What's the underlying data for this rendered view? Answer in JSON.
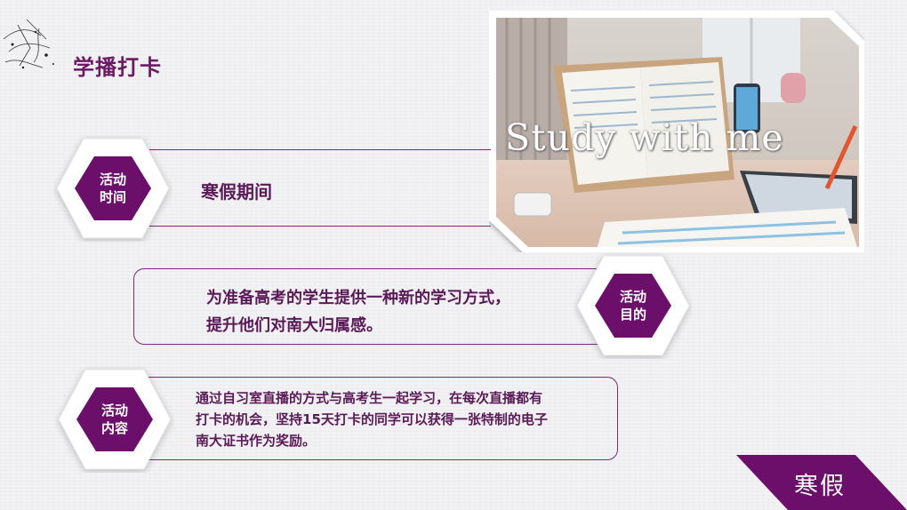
{
  "header": {
    "title": "学播打卡"
  },
  "photo": {
    "overlay_text": "Study with me"
  },
  "sections": [
    {
      "label_line1": "活动",
      "label_line2": "时间",
      "text": "寒假期间"
    },
    {
      "label_line1": "活动",
      "label_line2": "目的",
      "text_line1": "为准备高考的学生提供一种新的学习方式，",
      "text_line2": "提升他们对南大归属感。"
    },
    {
      "label_line1": "活动",
      "label_line2": "内容",
      "text_line1": "通过自习室直播的方式与高考生一起学习，在每次直播都有",
      "text_line2": "打卡的机会，坚持15天打卡的同学可以获得一张特制的电子",
      "text_line3": "南大证书作为奖励。"
    }
  ],
  "footer": {
    "tag": "寒假"
  },
  "colors": {
    "accent": "#6b0f6b",
    "text": "#5a1a57",
    "border": "#7b2a73"
  }
}
